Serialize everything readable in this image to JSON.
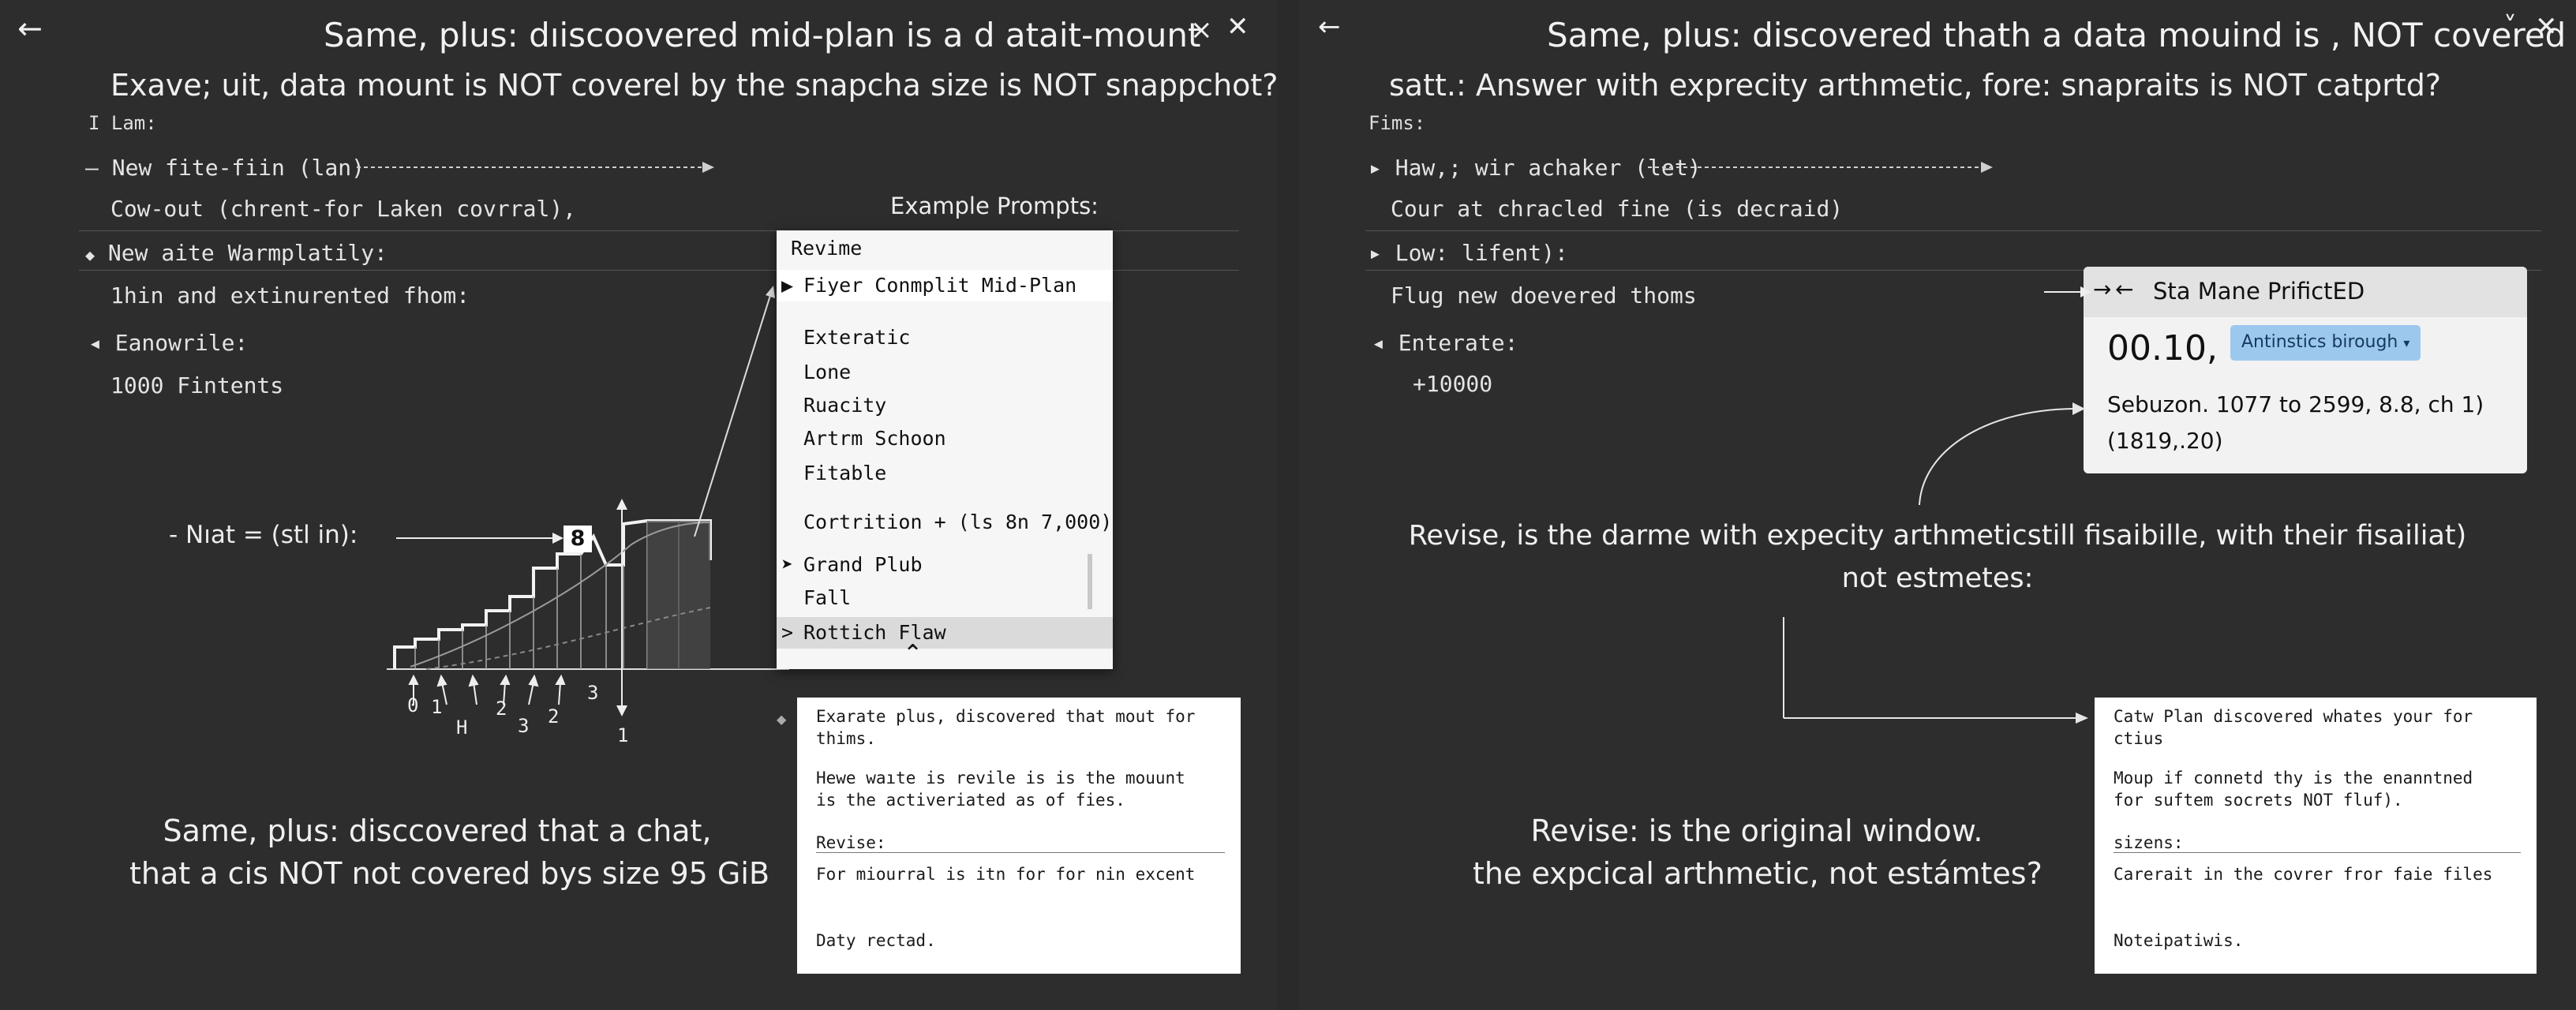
{
  "left": {
    "back_icon": "arrow-left-icon",
    "title": "Same, plus: dıiscoovered mid-plan  is a d atait-mount",
    "close_small": "×",
    "close_big": "✕",
    "subtitle": "Exave; uit, data mount is NOT coverel by the snapcha size is NOT snappchot?",
    "plan_label": "I Lam:",
    "items": [
      {
        "marker": "–",
        "text": "New fite-fiin (lan)"
      },
      {
        "marker": "",
        "text": "Cow-out (chrent-for Laken covrral),"
      },
      {
        "marker": "◆",
        "text": "New aite Warmplatily:"
      },
      {
        "marker": "",
        "text": "1hin and extinurented fhom:"
      },
      {
        "marker": "◂",
        "text": "Eanowrile:"
      },
      {
        "marker": "",
        "text": "1000 Fintents"
      }
    ],
    "example_prompts": "Example Prompts:",
    "menu": {
      "header": "Revime",
      "items": [
        {
          "arrow": "▶",
          "label": "Fiyer Conmplit Mid-Plan"
        },
        {
          "arrow": "",
          "label": "Exteratic"
        },
        {
          "arrow": "",
          "label": "Lone"
        },
        {
          "arrow": "",
          "label": "Ruacity"
        },
        {
          "arrow": "",
          "label": "Artrm Schoon"
        },
        {
          "arrow": "",
          "label": "Fitable"
        },
        {
          "arrow": "",
          "label": "Cortrition + (ls 8n 7,000)"
        },
        {
          "arrow": "➤",
          "label": "Grand Plub"
        },
        {
          "arrow": "",
          "label": "Fall"
        },
        {
          "arrow": ">",
          "label": "Rottich Flaw"
        }
      ]
    },
    "nat_label": "- Nıat = (stl in):",
    "nat_value": "8",
    "ticks": [
      "0",
      "1",
      "H",
      "2",
      "3",
      "2",
      "3",
      "1"
    ],
    "card": {
      "p1": "Exarate plus, discovered that mout for\nthims.",
      "p2": "Hewe waıte is revile is is the mouunt\nis the activeriated as of fies.",
      "section": "Revise:",
      "p3": "For miourral is itn for for nin excent",
      "p4": "Daty rectad."
    },
    "bottom": "Same, plus: disccovered that a chat,\nthat a cis NOT not covered bys size 95 GiB"
  },
  "right": {
    "back_icon": "arrow-left-icon",
    "title": "Same, plus:  discovered thath a data mouind is , NOT covered",
    "chevron": "˅",
    "subtitle": "satt.: Answer  with exprecity arthmetic, fore: snapraits is NOT catprtd?",
    "plan_label": "Fims:",
    "items": [
      {
        "marker": "▸",
        "text": "Haw,; wir achaker (let)"
      },
      {
        "marker": "",
        "text": "Cour at chracled fine (is decraid)"
      },
      {
        "marker": "▸",
        "text": "Low: lifent):"
      },
      {
        "marker": "",
        "text": "Flug new doevered thoms"
      },
      {
        "marker": "◂",
        "text": "Enterate:"
      },
      {
        "marker": "",
        "text": "+10000"
      }
    ],
    "popup": {
      "header": "Sta Mane PrifictED",
      "value": "00.10,",
      "chip": "Antinstics birough",
      "line1": "Sebuzon. 1077 to 2599, 8.8, ch 1)",
      "line2": "(1819,.20)"
    },
    "middle": "Revise, is the darme with expecity arthmeticstill fisaibille, with their fisailiat)\nnot estmetes:",
    "card": {
      "p1": "Catw Plan discovered whates your for\nctius",
      "p2": "Moup if connetd thy is the enanntned\nfor suftem socrets NOT fluf).",
      "section": "sizens:",
      "p3": "Carerait in the covrer fror faie files",
      "p4": "Noteipatiwis."
    },
    "bottom": "Revise: is the original window.\nthe expcical arthmetic, not estámtes?"
  },
  "colors": {
    "background": "#2d2d2d",
    "menu": "#f6f6f6",
    "chip": "#9cc8ee",
    "card": "#ffffff"
  }
}
